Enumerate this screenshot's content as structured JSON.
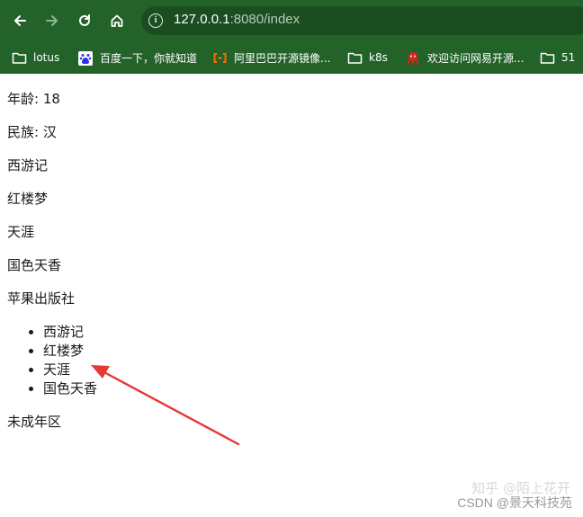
{
  "browser": {
    "url_host": "127.0.0.1",
    "url_rest": ":8080/index",
    "bookmarks": [
      {
        "label": "lotus",
        "icon": "folder-icon"
      },
      {
        "label": "百度一下，你就知道",
        "icon": "baidu-icon"
      },
      {
        "label": "阿里巴巴开源镜像...",
        "icon": "alibaba-icon"
      },
      {
        "label": "k8s",
        "icon": "folder-icon"
      },
      {
        "label": "欢迎访问网易开源...",
        "icon": "netease-icon"
      },
      {
        "label": "51",
        "icon": "folder-icon"
      }
    ]
  },
  "page": {
    "age": "年龄: 18",
    "ethnicity": "民族: 汉",
    "books": [
      "西游记",
      "红楼梦",
      "天涯",
      "国色天香"
    ],
    "publisher": "苹果出版社",
    "list_items": [
      "西游记",
      "红楼梦",
      "天涯",
      "国色天香"
    ],
    "minor_status": "未成年区"
  },
  "watermark": {
    "text": "CSDN @景天科技苑",
    "faint_text": "知乎 @陌上花开"
  },
  "colors": {
    "chrome_bg": "#23632a",
    "arrow": "#e53935"
  }
}
